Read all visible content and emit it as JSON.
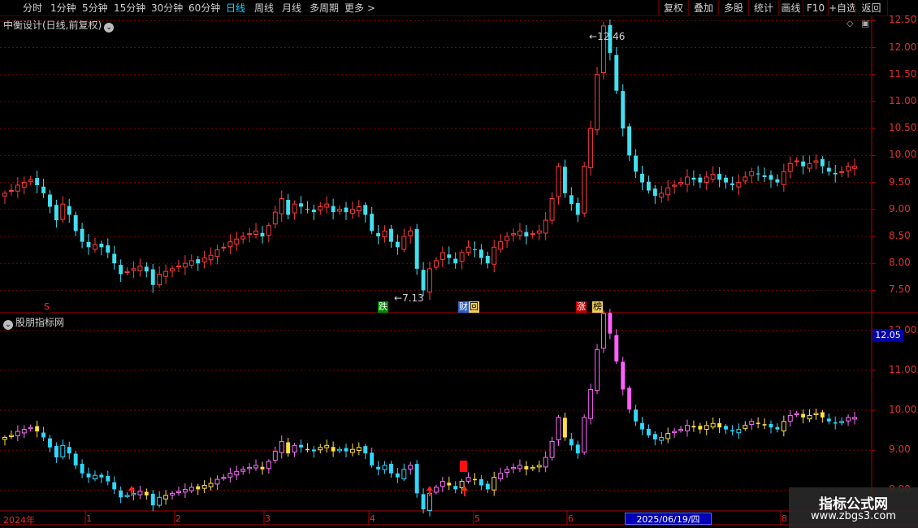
{
  "toolbar": {
    "periods": [
      "分时",
      "1分钟",
      "5分钟",
      "15分钟",
      "30分钟",
      "60分钟",
      "日线",
      "周线",
      "月线",
      "多周期",
      "更多 >"
    ],
    "active_period": "日线",
    "right_buttons": [
      "复权",
      "叠加",
      "多股",
      "统计",
      "画线",
      "F10",
      "+自选",
      "返回"
    ]
  },
  "main_panel": {
    "title": "中衡设计(日线,前复权)",
    "high_annotation": "12.46",
    "low_annotation": "7.13",
    "event_badges": [
      {
        "text": "S",
        "color": "#ff3030",
        "bg": "#000000"
      },
      {
        "text": "跌",
        "color": "#ffffff",
        "bg": "#008800"
      },
      {
        "text": "财",
        "color": "#ffffff",
        "bg": "#3060c0"
      },
      {
        "text": "回",
        "color": "#000000",
        "bg": "#f0d060"
      },
      {
        "text": "涨",
        "color": "#ffffff",
        "bg": "#c00000"
      },
      {
        "text": "榜",
        "color": "#000000",
        "bg": "#f0d060"
      }
    ]
  },
  "sub_panel": {
    "title": "股朋指标网",
    "current_price": "12.05"
  },
  "x_axis": {
    "labels": [
      "2024年",
      "1",
      "2",
      "3",
      "4",
      "5",
      "6",
      "8"
    ],
    "cursor_date": "2025/06/19/四"
  },
  "watermark": {
    "title": "指标公式网",
    "url": "www.zbgs3.com"
  },
  "chart_data": [
    {
      "type": "candlestick",
      "title": "中衡设计(日线,前复权)",
      "y_ticks": [
        "12.50",
        "12.00",
        "11.50",
        "11.00",
        "10.50",
        "10.00",
        "9.50",
        "9.00",
        "8.50",
        "8.00",
        "7.50"
      ],
      "ylim": [
        7.1,
        12.55
      ],
      "high": 12.46,
      "low": 7.13,
      "close_series": [
        9.3,
        9.35,
        9.45,
        9.5,
        9.55,
        9.45,
        9.3,
        9.05,
        8.8,
        9.1,
        8.9,
        8.6,
        8.4,
        8.3,
        8.35,
        8.3,
        8.2,
        8.0,
        7.8,
        7.85,
        7.9,
        7.95,
        7.85,
        7.6,
        7.8,
        7.85,
        7.9,
        7.95,
        8.0,
        8.05,
        8.0,
        8.1,
        8.15,
        8.25,
        8.3,
        8.4,
        8.45,
        8.5,
        8.55,
        8.6,
        8.5,
        8.7,
        8.95,
        9.2,
        8.9,
        9.1,
        9.05,
        9.0,
        8.95,
        9.05,
        9.1,
        8.95,
        9.0,
        8.95,
        9.0,
        9.05,
        8.9,
        8.6,
        8.5,
        8.6,
        8.4,
        8.3,
        8.5,
        8.6,
        7.9,
        7.5,
        7.9,
        8.05,
        8.2,
        8.1,
        8.0,
        8.2,
        8.3,
        8.25,
        8.1,
        8.0,
        8.3,
        8.4,
        8.5,
        8.55,
        8.6,
        8.5,
        8.55,
        8.6,
        8.8,
        9.2,
        9.8,
        9.3,
        9.1,
        8.9,
        9.8,
        10.5,
        11.5,
        12.4,
        11.9,
        11.2,
        10.5,
        10.0,
        9.7,
        9.5,
        9.35,
        9.25,
        9.3,
        9.4,
        9.45,
        9.5,
        9.6,
        9.55,
        9.5,
        9.6,
        9.65,
        9.55,
        9.5,
        9.45,
        9.5,
        9.6,
        9.7,
        9.65,
        9.6,
        9.55,
        9.5,
        9.7,
        9.85,
        9.9,
        9.8,
        9.85,
        9.9,
        9.8,
        9.7,
        9.65,
        9.7,
        9.8,
        9.8
      ]
    },
    {
      "type": "candlestick",
      "title": "股朋指标网",
      "y_ticks": [
        "12.00",
        "11.00",
        "10.00",
        "9.00",
        "8.00"
      ],
      "ylim": [
        7.5,
        12.4
      ],
      "current": 12.05,
      "signals": [
        "buy",
        "buy",
        "buy"
      ]
    }
  ]
}
